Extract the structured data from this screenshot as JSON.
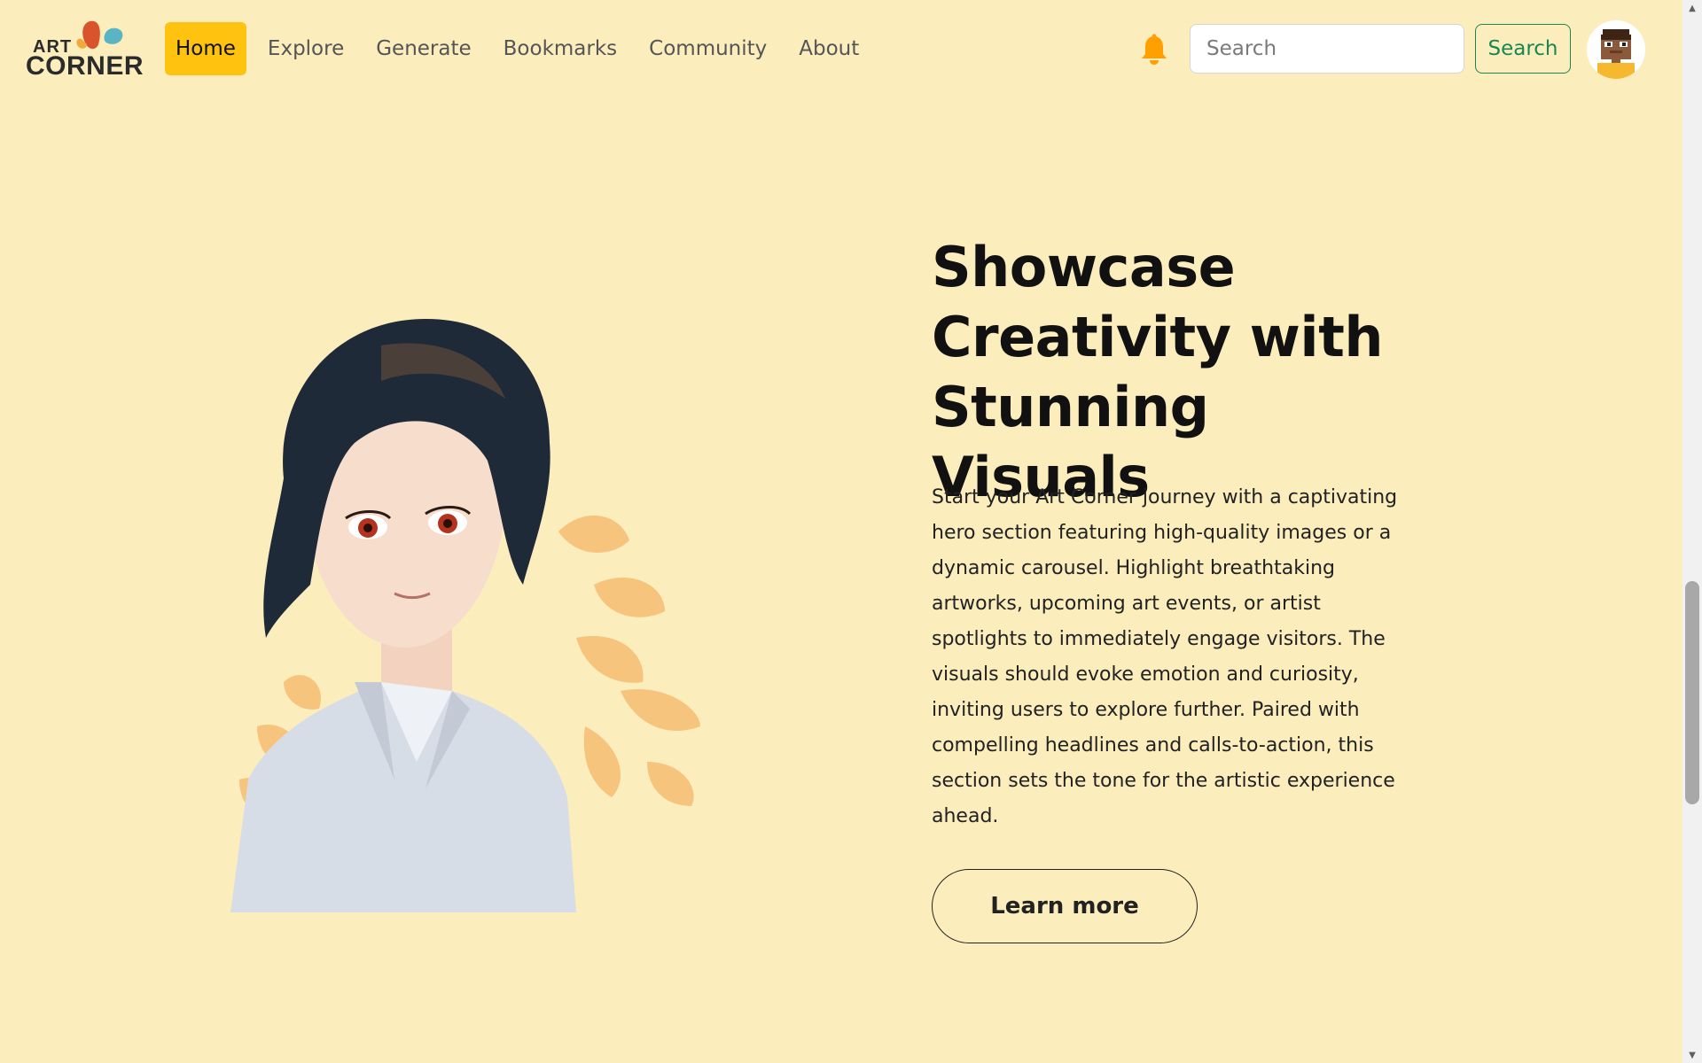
{
  "brand": {
    "logo_line1": "ART",
    "logo_line2": "CORNER",
    "logo_colors": [
      "#d9532b",
      "#f0a93b",
      "#5bb4c4"
    ]
  },
  "nav": {
    "items": [
      {
        "label": "Home",
        "active": true
      },
      {
        "label": "Explore",
        "active": false
      },
      {
        "label": "Generate",
        "active": false
      },
      {
        "label": "Bookmarks",
        "active": false
      },
      {
        "label": "Community",
        "active": false
      },
      {
        "label": "About",
        "active": false
      }
    ],
    "notification_icon": "bell-icon",
    "search_placeholder": "Search",
    "search_value": "",
    "search_button": "Search",
    "avatar_icon": "pixel-avatar"
  },
  "hero": {
    "title": "Showcase Creativity with Stunning Visuals",
    "description": "Start your Art Corner journey with a captivating hero section featuring high-quality images or a dynamic carousel. Highlight breathtaking artworks, upcoming art events, or artist spotlights to immediately engage visitors. The visuals should evoke emotion and curiosity, inviting users to explore further. Paired with compelling headlines and calls-to-action, this section sets the tone for the artistic experience ahead.",
    "cta": "Learn more",
    "image_icon": "anime-portrait-illustration"
  },
  "colors": {
    "background": "#fcedbd",
    "accent": "#ffc20e",
    "search_button": "#198754",
    "bell": "#ffa000"
  }
}
